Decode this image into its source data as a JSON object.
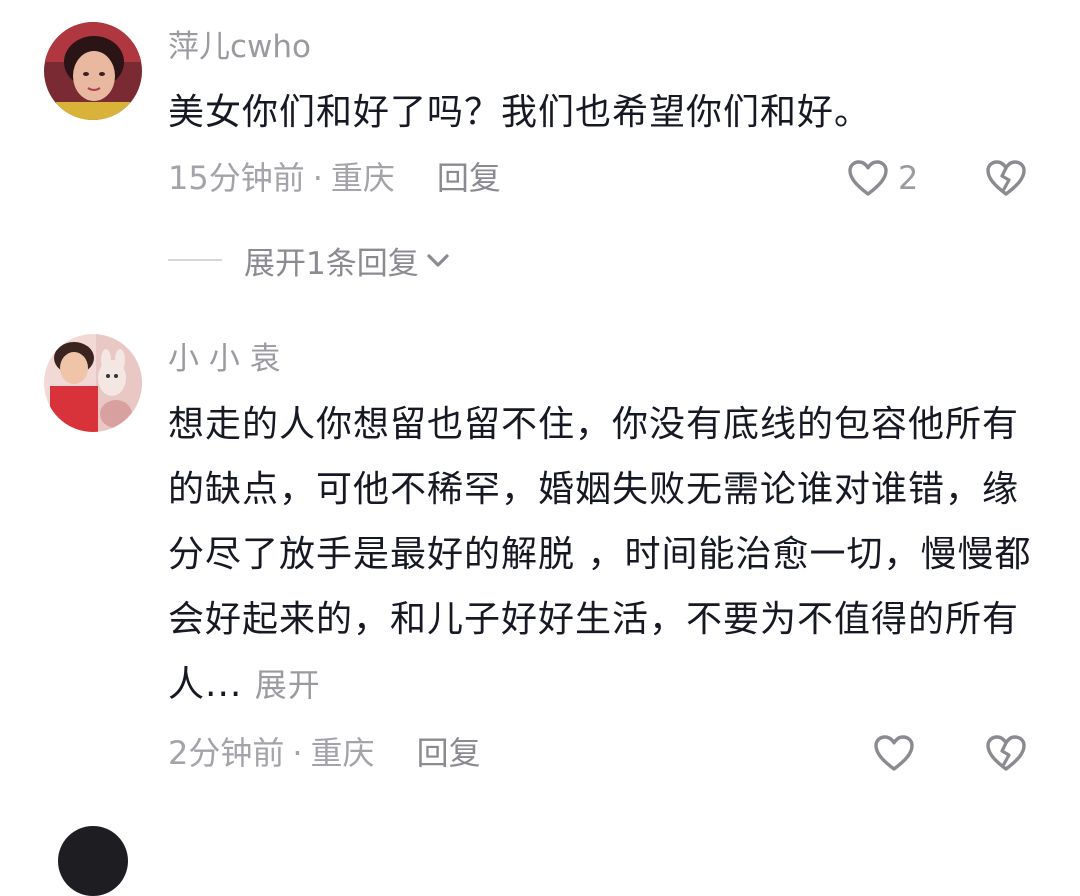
{
  "comments": [
    {
      "username": "萍儿cwho",
      "text": "美女你们和好了吗？我们也希望你们和好。",
      "time": "15分钟前",
      "separator": "·",
      "location": "重庆",
      "reply_label": "回复",
      "like_count": "2",
      "show_replies_label": "展开1条回复"
    },
    {
      "username": "小 小 袁",
      "text": "想走的人你想留也留不住，你没有底线的包容他所有的缺点，可他不稀罕，婚姻失败无需论谁对谁错，缘分尽了放手是最好的解脱 ，时间能治愈一切，慢慢都会好起来的，和儿子好好生活，不要为不值得的所有人...",
      "expand_label": "展开",
      "time": "2分钟前",
      "separator": "·",
      "location": "重庆",
      "reply_label": "回复",
      "like_count": ""
    }
  ],
  "colors": {
    "text_primary": "#161823",
    "text_secondary": "#9a9aa0",
    "icon_stroke": "#8a8a91"
  },
  "icons": {
    "like": "heart-outline-icon",
    "dislike": "broken-heart-icon",
    "expand": "chevron-down-icon"
  }
}
